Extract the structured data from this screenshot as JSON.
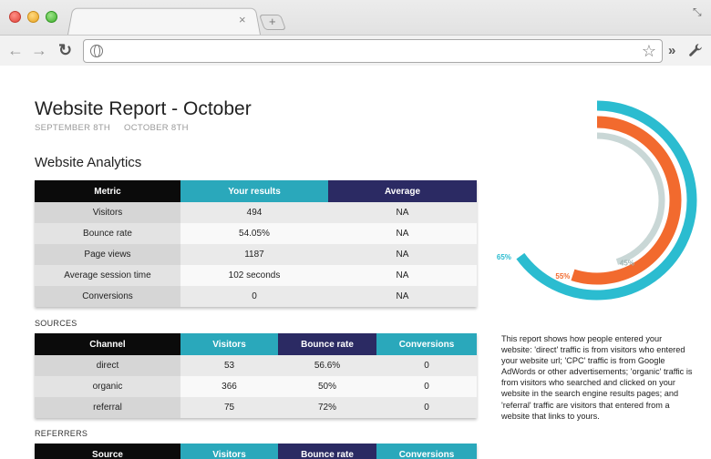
{
  "browser": {
    "tab_close": "×",
    "new_tab": "+",
    "address": "",
    "icons": {
      "back": "arrow-left-icon",
      "forward": "arrow-right-icon",
      "reload": "reload-icon",
      "globe": "globe-icon",
      "bookmark": "star-icon",
      "extensions": "chevrons-icon",
      "menu": "wrench-icon",
      "resize": "resize-icon"
    }
  },
  "report": {
    "title": "Website Report - October",
    "date_start": "SEPTEMBER 8TH",
    "date_end": "OCTOBER 8TH",
    "section_title": "Website Analytics"
  },
  "analytics_table": {
    "headers": [
      "Metric",
      "Your results",
      "Average"
    ],
    "rows": [
      [
        "Visitors",
        "494",
        "NA"
      ],
      [
        "Bounce rate",
        "54.05%",
        "NA"
      ],
      [
        "Page views",
        "1187",
        "NA"
      ],
      [
        "Average session time",
        "102 seconds",
        "NA"
      ],
      [
        "Conversions",
        "0",
        "NA"
      ]
    ]
  },
  "sources": {
    "label": "SOURCES",
    "headers": [
      "Channel",
      "Visitors",
      "Bounce rate",
      "Conversions"
    ],
    "rows": [
      [
        "direct",
        "53",
        "56.6%",
        "0"
      ],
      [
        "organic",
        "366",
        "50%",
        "0"
      ],
      [
        "referral",
        "75",
        "72%",
        "0"
      ]
    ]
  },
  "referrers": {
    "label": "REFERRERS",
    "headers": [
      "Source",
      "Visitors",
      "Bounce rate",
      "Conversions"
    ]
  },
  "radial": {
    "rings": [
      {
        "label": "65%",
        "value": 65,
        "color": "#2bbcd0"
      },
      {
        "label": "55%",
        "value": 55,
        "color": "#f26a2e"
      },
      {
        "label": "45%",
        "value": 45,
        "color": "#c9d7d6"
      }
    ]
  },
  "description": "This report shows how people entered your website: 'direct' traffic is from visitors who entered your website url; 'CPC' traffic is from Google AdWords or other advertisements; 'organic' traffic is from visitors who searched and clicked on your website in the search engine results pages; and 'referral' traffic are visitors that entered from a website that links to yours."
}
